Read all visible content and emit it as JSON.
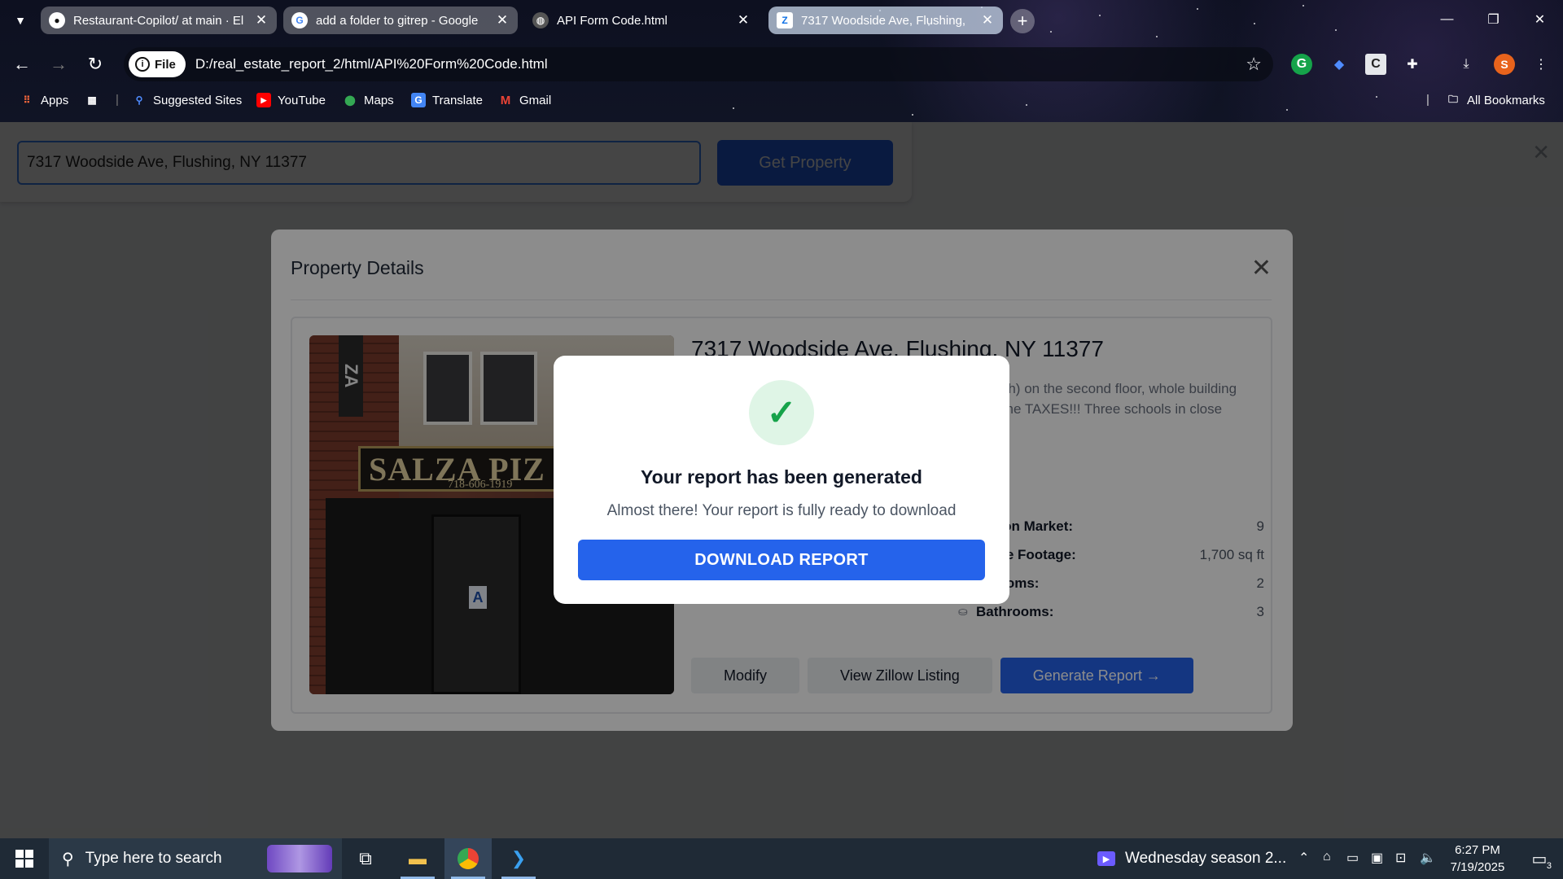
{
  "browser": {
    "tabs": [
      {
        "label": "Restaurant-Copilot/ at main · El",
        "favicon": "github-icon"
      },
      {
        "label": "add a folder to gitrep - Google",
        "favicon": "google-icon"
      },
      {
        "label": "API Form Code.html",
        "favicon": "globe-icon"
      },
      {
        "label": "7317 Woodside Ave, Flushing,",
        "favicon": "zillow-icon"
      }
    ],
    "site_chip": "File",
    "url": "D:/real_estate_report_2/html/API%20Form%20Code.html",
    "profile_initial": "S",
    "bookmarks": [
      {
        "label": "Apps"
      },
      {
        "label": "Suggested Sites"
      },
      {
        "label": "YouTube"
      },
      {
        "label": "Maps"
      },
      {
        "label": "Translate"
      },
      {
        "label": "Gmail"
      }
    ],
    "all_bookmarks": "All Bookmarks"
  },
  "search": {
    "address_value": "7317 Woodside Ave, Flushing, NY 11377",
    "get_button": "Get Property"
  },
  "details_modal": {
    "title": "Property Details",
    "property_title": "7317 Woodside Ave, Flushing, NY 11377",
    "description": "use building consisting of ground floor 3edroom each) on the second floor, whole building can be delivered proximately 840 square feet, and the TAXES!!! Three schools in close",
    "photo": {
      "sign": "SALZA PIZ",
      "phone": "718-606-1919",
      "door_letter": "A",
      "vertical_sign": "ZA"
    },
    "stats": [
      {
        "label": "ays on Market:",
        "value": "9"
      },
      {
        "label": "quare Footage:",
        "value": "1,700 sq ft"
      },
      {
        "label": "edrooms:",
        "value": "2"
      },
      {
        "label": "Bathrooms:",
        "value": "3"
      }
    ],
    "actions": {
      "modify": "Modify",
      "zillow": "View Zillow Listing",
      "generate": "Generate Report →"
    }
  },
  "success_modal": {
    "title": "Your report has been generated",
    "subtitle": "Almost there! Your report is fully ready to download",
    "button": "DOWNLOAD REPORT"
  },
  "taskbar": {
    "search_placeholder": "Type here to search",
    "media_title": "Wednesday season 2...",
    "time": "6:27 PM",
    "date": "7/19/2025",
    "notification_count": "3"
  },
  "colors": {
    "accent": "#2563eb",
    "success": "#16a34a",
    "success_bg": "#dff5e6"
  }
}
